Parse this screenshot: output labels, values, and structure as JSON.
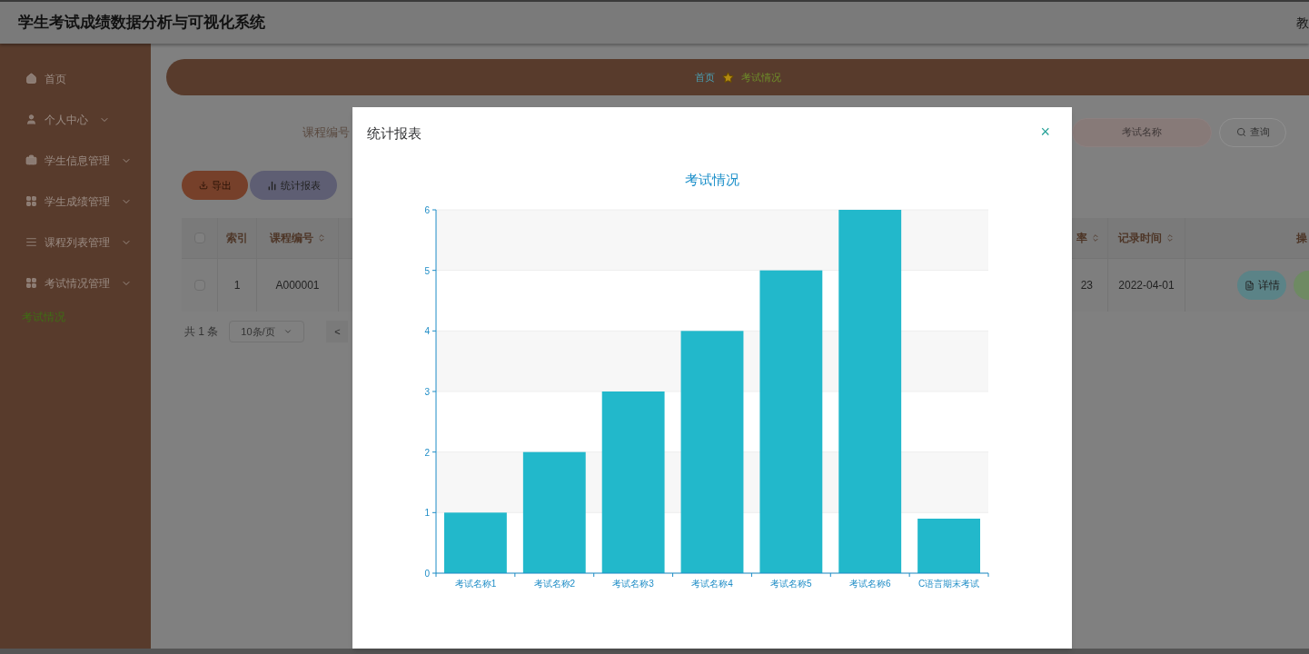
{
  "header": {
    "title": "学生考试成绩数据分析与可视化系统",
    "user": "教"
  },
  "sidebar": {
    "items": [
      {
        "label": "首页",
        "arrow": false
      },
      {
        "label": "个人中心",
        "arrow": true
      },
      {
        "label": "学生信息管理",
        "arrow": true
      },
      {
        "label": "学生成绩管理",
        "arrow": true
      },
      {
        "label": "课程列表管理",
        "arrow": true
      },
      {
        "label": "考试情况管理",
        "arrow": true,
        "children": [
          {
            "label": "考试情况",
            "selected": true
          }
        ]
      }
    ]
  },
  "breadcrumb": [
    "首页",
    "考试情况"
  ],
  "search": {
    "label": "课程编号",
    "placeholder": "考试名称",
    "button": "查询"
  },
  "actions": [
    "导出",
    "统计报表"
  ],
  "table": {
    "all_checked": false,
    "columns": [
      "索引",
      "课程编号",
      "率",
      "记录时间",
      "操"
    ],
    "rows": [
      {
        "cells": [
          "1",
          "A000001",
          "23",
          "2022-04-01"
        ],
        "checked": false,
        "actions": [
          "详情"
        ]
      }
    ]
  },
  "pagination": {
    "total": "共 1 条",
    "page_size": "10条/页",
    "prev": "<"
  },
  "modal": {
    "title": "统计报表",
    "close": "×",
    "chart_data": {
      "type": "bar",
      "title": "考试情况",
      "categories": [
        "考试名称1",
        "考试名称2",
        "考试名称3",
        "考试名称4",
        "考试名称5",
        "考试名称6",
        "C语言期末考试"
      ],
      "series": [
        {
          "color": "#22b8cb",
          "values": [
            1,
            2,
            3,
            4,
            5,
            6,
            0.9
          ]
        }
      ],
      "grid": true,
      "ylim": [
        0,
        6
      ],
      "yticks": [
        0,
        1,
        2,
        3,
        4,
        5,
        6
      ]
    }
  }
}
